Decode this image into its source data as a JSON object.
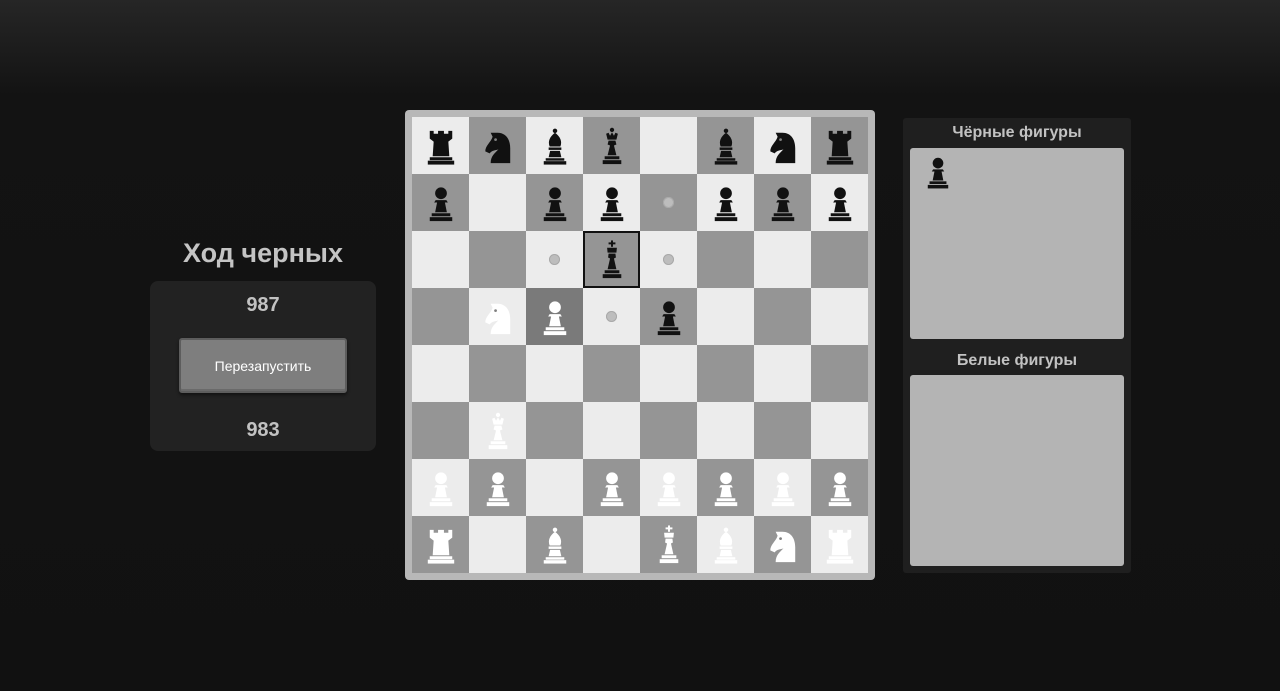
{
  "game": {
    "turn_label": "Ход черных",
    "timer_top": "987",
    "timer_bottom": "983",
    "restart_label": "Перезапустить"
  },
  "captured": {
    "black_title": "Чёрные фигуры",
    "white_title": "Белые фигуры",
    "black_pieces": [
      "pawn"
    ],
    "white_pieces": []
  },
  "board": {
    "rows": [
      [
        "bR",
        "bN",
        "bB",
        "bQ",
        "",
        "bB",
        "bN",
        "bR"
      ],
      [
        "bP",
        "",
        "bP",
        "bP",
        "",
        "bP",
        "bP",
        "bP"
      ],
      [
        "",
        "",
        "",
        "bK",
        "",
        "",
        "",
        ""
      ],
      [
        "",
        "wN",
        "wP",
        "",
        "bP",
        "",
        "",
        ""
      ],
      [
        "",
        "",
        "",
        "",
        "",
        "",
        "",
        ""
      ],
      [
        "",
        "wQ",
        "",
        "",
        "",
        "",
        "",
        ""
      ],
      [
        "wP",
        "wP",
        "",
        "wP",
        "wP",
        "wP",
        "wP",
        "wP"
      ],
      [
        "wR",
        "",
        "wB",
        "",
        "wK",
        "wB",
        "wN",
        "wR"
      ]
    ],
    "selected": [
      2,
      3
    ],
    "last_move": [
      3,
      2
    ],
    "move_hints": [
      [
        1,
        4
      ],
      [
        2,
        2
      ],
      [
        2,
        4
      ],
      [
        3,
        3
      ]
    ]
  },
  "colors": {
    "light_square": "#ececec",
    "dark_square": "#959595",
    "board_border": "#b8b8b8",
    "black_piece": "#111111",
    "white_piece": "#ffffff"
  }
}
